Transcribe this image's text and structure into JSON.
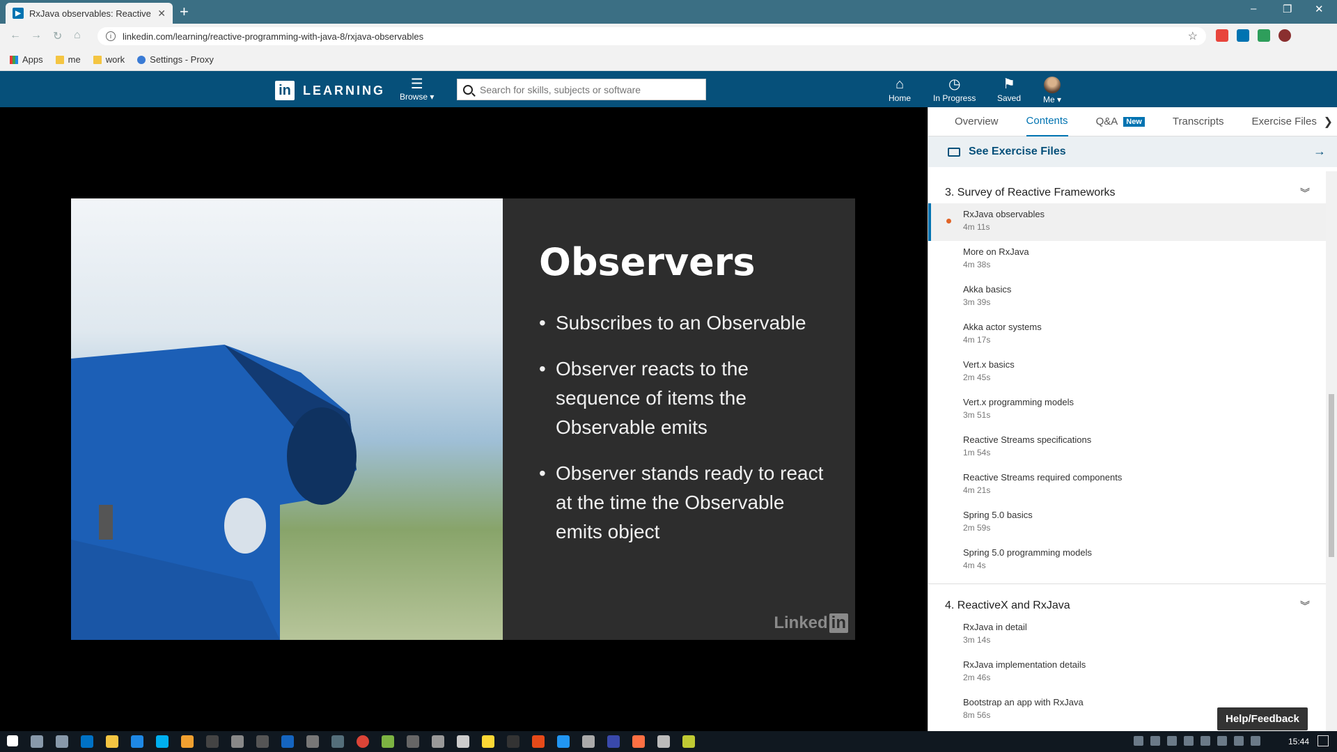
{
  "browser": {
    "tab_title": "RxJava observables: Reactive",
    "url": "linkedin.com/learning/reactive-programming-with-java-8/rxjava-observables",
    "bookmarks": [
      "Apps",
      "me",
      "work",
      "Settings - Proxy"
    ]
  },
  "header": {
    "logo_text": "LEARNING",
    "browse_label": "Browse ▾",
    "search_placeholder": "Search for skills, subjects or software",
    "nav": {
      "home": "Home",
      "in_progress": "In Progress",
      "saved": "Saved",
      "me": "Me ▾"
    }
  },
  "slide": {
    "title": "Observers",
    "bullets": [
      "Subscribes to an Observable",
      "Observer reacts to the sequence of items the Observable emits",
      "Observer stands ready to react at the time the Observable emits object"
    ],
    "watermark_word": "Linked",
    "watermark_in": "in"
  },
  "panel": {
    "tabs": {
      "overview": "Overview",
      "contents": "Contents",
      "qa": "Q&A",
      "qa_badge": "New",
      "transcripts": "Transcripts",
      "exercise": "Exercise Files"
    },
    "see_exercise_files": "See Exercise Files",
    "sections": [
      {
        "title": "3. Survey of Reactive Frameworks",
        "items": [
          {
            "name": "RxJava observables",
            "dur": "4m 11s"
          },
          {
            "name": "More on RxJava",
            "dur": "4m 38s"
          },
          {
            "name": "Akka basics",
            "dur": "3m 39s"
          },
          {
            "name": "Akka actor systems",
            "dur": "4m 17s"
          },
          {
            "name": "Vert.x basics",
            "dur": "2m 45s"
          },
          {
            "name": "Vert.x programming models",
            "dur": "3m 51s"
          },
          {
            "name": "Reactive Streams specifications",
            "dur": "1m 54s"
          },
          {
            "name": "Reactive Streams required components",
            "dur": "4m 21s"
          },
          {
            "name": "Spring 5.0 basics",
            "dur": "2m 59s"
          },
          {
            "name": "Spring 5.0 programming models",
            "dur": "4m 4s"
          }
        ]
      },
      {
        "title": "4. ReactiveX and RxJava",
        "items": [
          {
            "name": "RxJava in detail",
            "dur": "3m 14s"
          },
          {
            "name": "RxJava implementation details",
            "dur": "2m 46s"
          },
          {
            "name": "Bootstrap an app with RxJava",
            "dur": "8m 56s"
          }
        ]
      }
    ],
    "help_label": "Help/Feedback"
  },
  "taskbar": {
    "clock": "15:44"
  },
  "colors": {
    "brand": "#06507a",
    "accent": "#0073b1",
    "current_dot": "#e16427",
    "chrome_frame": "#3b6f84"
  }
}
